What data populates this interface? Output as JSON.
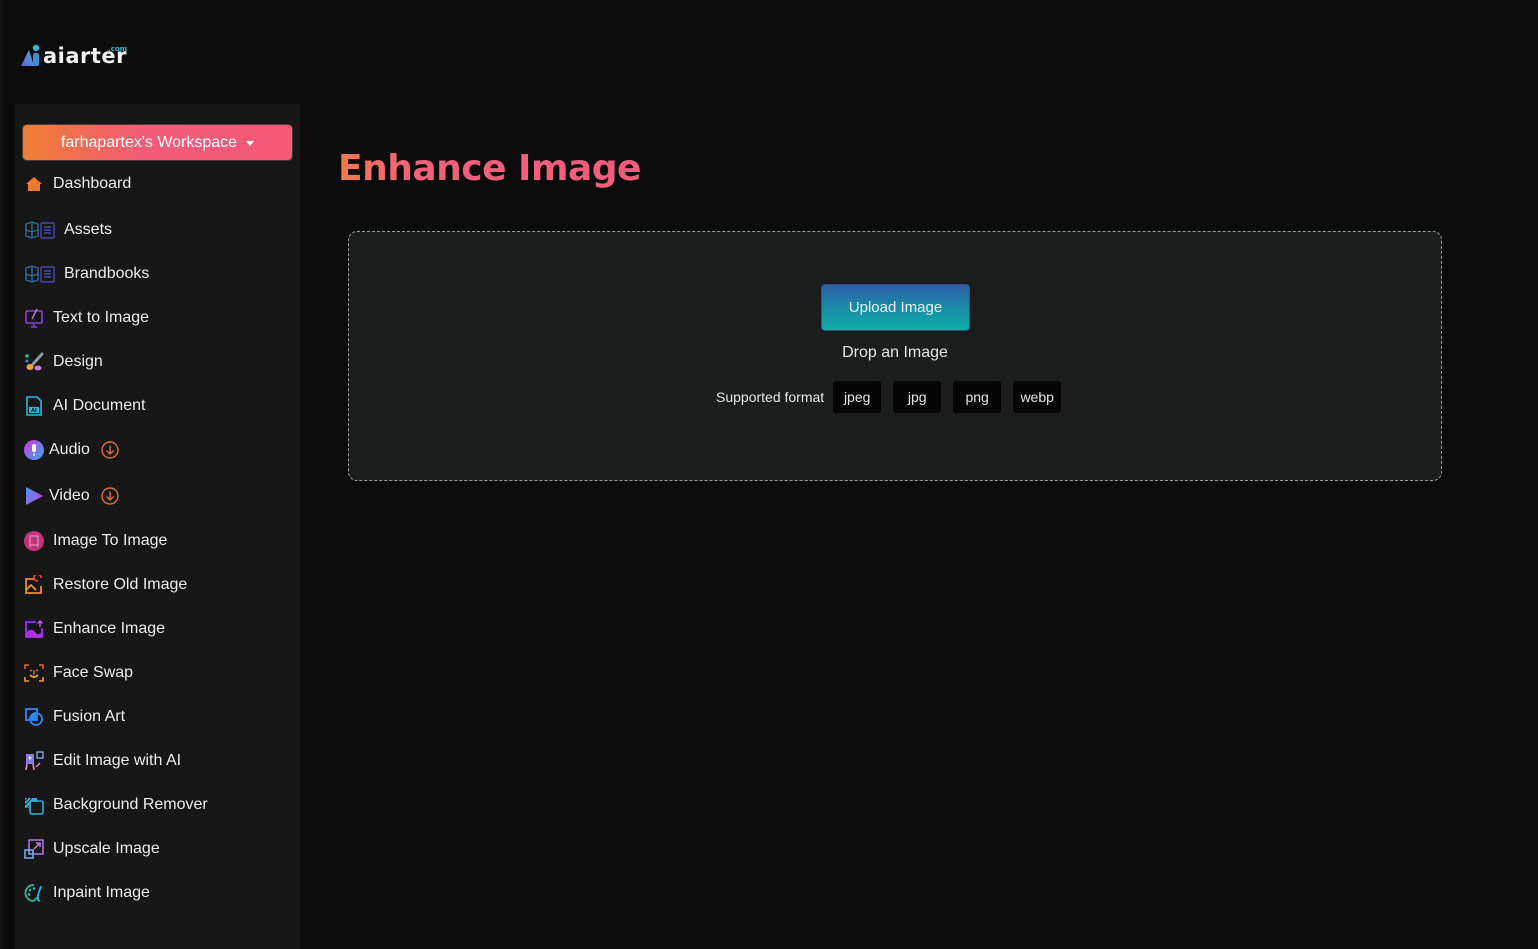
{
  "brand": {
    "name": "aiarter",
    "suffix": ".com"
  },
  "sidebar": {
    "workspace_label": "farhapartex's Workspace",
    "items": [
      {
        "label": "Dashboard",
        "icon": "home-icon"
      },
      {
        "label": "Assets",
        "icon": "assets-icon"
      },
      {
        "label": "Brandbooks",
        "icon": "brandbooks-icon"
      },
      {
        "label": "Text to Image",
        "icon": "text-to-image-icon"
      },
      {
        "label": "Design",
        "icon": "paintbrush-icon"
      },
      {
        "label": "AI Document",
        "icon": "ai-document-icon"
      },
      {
        "label": "Audio",
        "icon": "microphone-icon",
        "badge": "download-icon"
      },
      {
        "label": "Video",
        "icon": "play-icon",
        "badge": "download-icon"
      },
      {
        "label": "Image To Image",
        "icon": "image-to-image-icon"
      },
      {
        "label": "Restore Old Image",
        "icon": "restore-image-icon"
      },
      {
        "label": "Enhance Image",
        "icon": "enhance-image-icon"
      },
      {
        "label": "Face Swap",
        "icon": "face-scan-icon"
      },
      {
        "label": "Fusion Art",
        "icon": "fusion-art-icon"
      },
      {
        "label": "Edit Image with AI",
        "icon": "easel-icon"
      },
      {
        "label": "Background Remover",
        "icon": "background-remover-icon"
      },
      {
        "label": "Upscale Image",
        "icon": "upscale-icon"
      },
      {
        "label": "Inpaint Image",
        "icon": "palette-icon"
      }
    ]
  },
  "main": {
    "title": "Enhance Image",
    "upload_button": "Upload Image",
    "drop_text": "Drop an Image",
    "supported_label": "Supported format",
    "formats": [
      "jpeg",
      "jpg",
      "png",
      "webp"
    ]
  },
  "colors": {
    "accent_orange": "#f08033",
    "accent_pink": "#f25c78",
    "upload_top": "#2a5fa8",
    "upload_bottom": "#0bb1a6",
    "background": "#0b0b0c",
    "sidebar": "#161616",
    "dropzone": "#1b1c1c"
  }
}
